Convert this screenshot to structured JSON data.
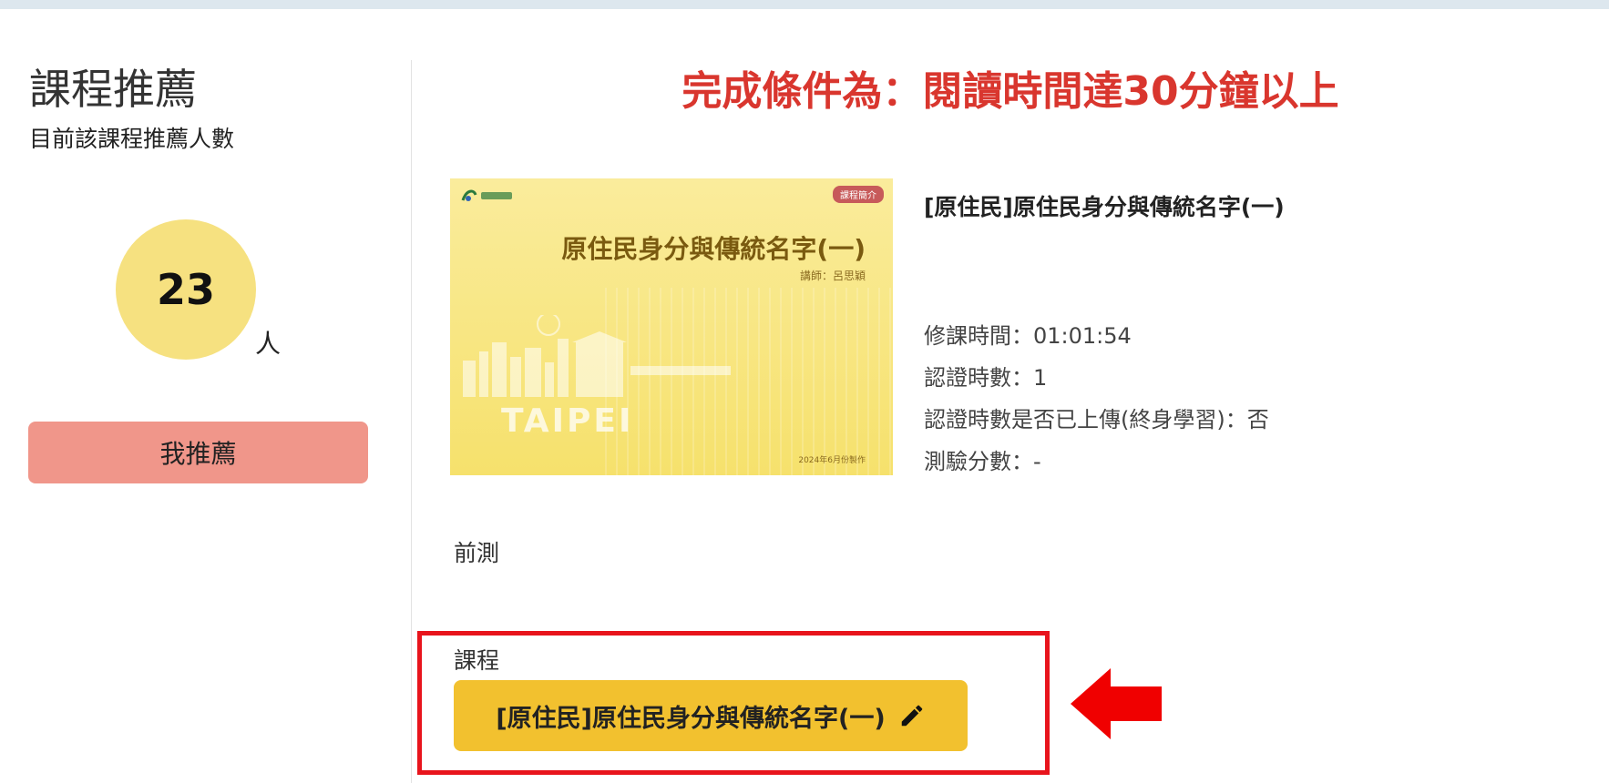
{
  "recommendation": {
    "title": "課程推薦",
    "subtitle": "目前該課程推薦人數",
    "count": "23",
    "unit": "人",
    "button_label": "我推薦"
  },
  "completion_condition": "完成條件為：閱讀時間達30分鐘以上",
  "thumbnail": {
    "badge": "課程簡介",
    "title": "原住民身分與傳統名字(一)",
    "lecturer": "講師：呂思穎",
    "city": "TAIPEI",
    "date": "2024年6月份製作"
  },
  "course": {
    "name": "[原住民]原住民身分與傳統名字(一)",
    "info": [
      "修課時間：01:01:54",
      "認證時數：1",
      "認證時數是否已上傳(終身學習)：否",
      "測驗分數：-"
    ]
  },
  "sections": {
    "pretest_label": "前測",
    "course_label": "課程",
    "course_button": "[原住民]原住民身分與傳統名字(一)"
  },
  "colors": {
    "completion_text": "#d9362e",
    "count_circle": "#f6e180",
    "recommend_button": "#f0968a",
    "course_button": "#f2c12f",
    "highlight": "#e8141c"
  },
  "icons": {
    "course_button_icon": "pencil-icon",
    "annotation": "arrow-left-icon"
  }
}
